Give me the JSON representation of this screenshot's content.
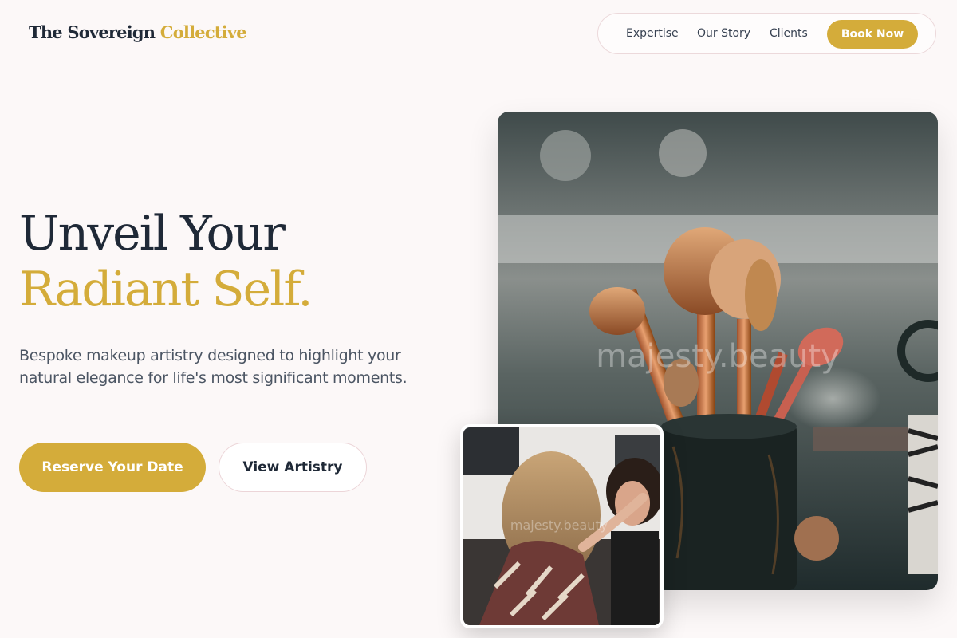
{
  "header": {
    "logo_main": "The Sovereign",
    "logo_accent": "Collective",
    "nav": [
      {
        "label": "Expertise"
      },
      {
        "label": "Our Story"
      },
      {
        "label": "Clients"
      }
    ],
    "book_label": "Book Now"
  },
  "hero": {
    "title_line1": "Unveil Your",
    "title_line2": "Radiant Self.",
    "subtitle": "Bespoke makeup artistry designed to highlight your natural elegance for life's most significant moments.",
    "primary_cta": "Reserve Your Date",
    "secondary_cta": "View Artistry"
  },
  "images": {
    "main_watermark": "majesty.beauty",
    "inset_watermark": "majesty.beauty"
  },
  "colors": {
    "accent": "#d4ac3a",
    "heading": "#1f2937",
    "background": "#fcf8f8"
  }
}
